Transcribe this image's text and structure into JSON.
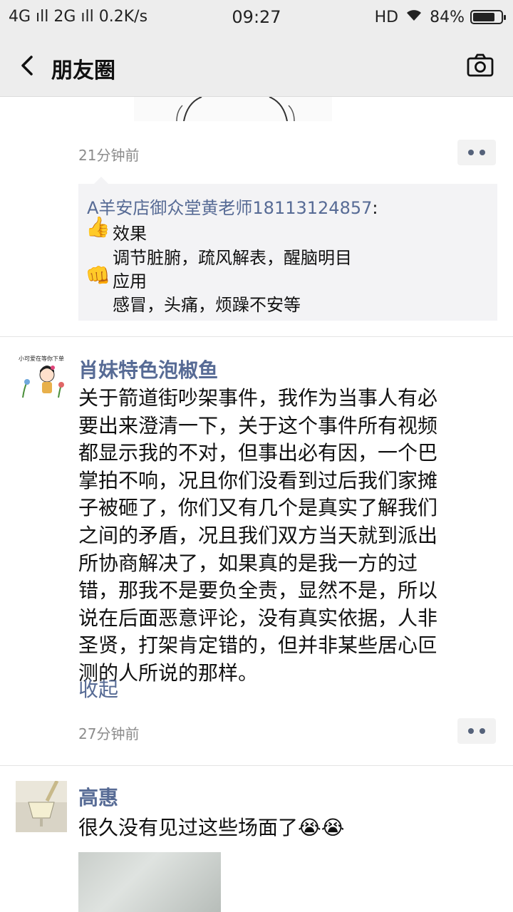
{
  "status_bar": {
    "left": "4G  ıll  2G  ıll  0.2K/s",
    "time": "09:27",
    "hd": "HD",
    "battery": "84%",
    "battery_level": 0.84
  },
  "nav": {
    "title": "朋友圈"
  },
  "post1": {
    "time": "21分钟前",
    "comment": {
      "author": "A羊安店御众堂黄老师18113124857",
      "colon": ":",
      "line1_emoji": "👍",
      "line1": "效果",
      "line2": "调节脏腑，疏风解表，醒脑明目",
      "line3_emoji": "👊",
      "line3": "应用",
      "line4": "感冒，头痛，烦躁不安等"
    }
  },
  "post2": {
    "avatar_caption": "小可爱在等你下单",
    "username": "肖妹特色泡椒鱼",
    "lines": [
      "关于箭道街吵架事件，我作为当事人有必",
      "要出来澄清一下，关于这个事件所有视频",
      "都显示我的不对，但事出必有因，一个巴",
      "掌拍不响，况且你们没看到过后我们家摊",
      "子被砸了，你们又有几个是真实了解我们",
      "之间的矛盾，况且我们双方当天就到派出",
      "所协商解决了，如果真的是我一方的过",
      "错，那我不是要负全责，显然不是，所以",
      "说在后面恶意评论，没有真实依据，人非",
      "圣贤，打架肯定错的，但并非某些居心叵",
      "测的人所说的那样。"
    ],
    "collapse": "收起",
    "time": "27分钟前"
  },
  "post3": {
    "username": "高惠",
    "text": "很久没有见过这些场面了😭😭"
  }
}
